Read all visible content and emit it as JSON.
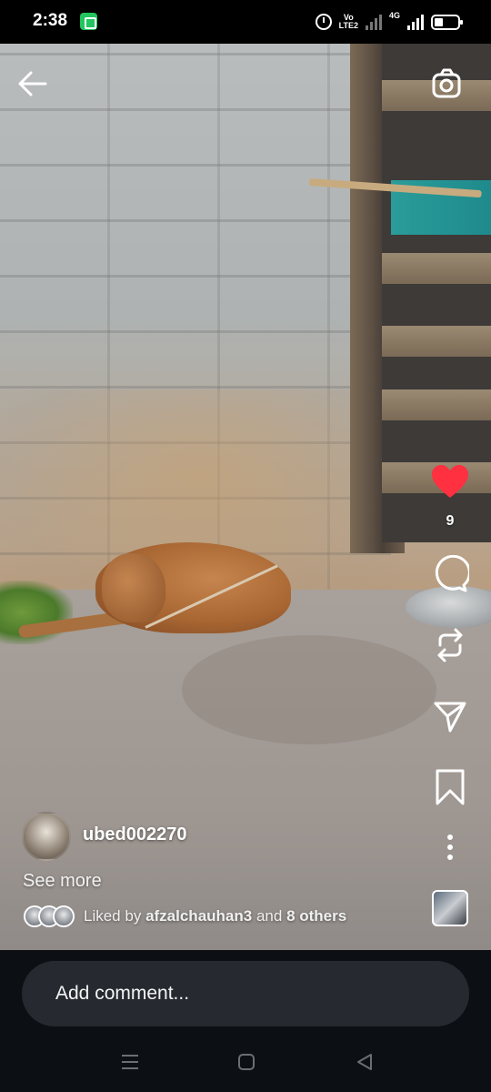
{
  "status_bar": {
    "time": "2:38",
    "network_label": "4G",
    "volte_label": "Vo\nLTE2",
    "icons": [
      "app-notification-icon",
      "alarm-icon",
      "volte-icon",
      "signal-icon",
      "battery-icon"
    ]
  },
  "top_bar": {
    "back_icon": "arrow-left-icon",
    "camera_icon": "camera-icon"
  },
  "actions": {
    "like_icon": "heart-icon",
    "like_count": "9",
    "liked": true,
    "like_color": "#ff3040",
    "comment_icon": "comment-icon",
    "repost_icon": "repost-icon",
    "share_icon": "send-icon",
    "save_icon": "bookmark-icon",
    "more_icon": "more-vertical-icon"
  },
  "post": {
    "username": "ubed002270",
    "see_more_label": "See more",
    "liked_by_prefix": "Liked by",
    "liked_by_user": "afzalchauhan3",
    "liked_by_and": "and",
    "liked_by_others": "8 others"
  },
  "comment": {
    "placeholder": "Add comment..."
  },
  "nav_bar": {
    "recents_icon": "menu-icon",
    "home_icon": "home-square-icon",
    "back_icon": "back-triangle-icon"
  }
}
